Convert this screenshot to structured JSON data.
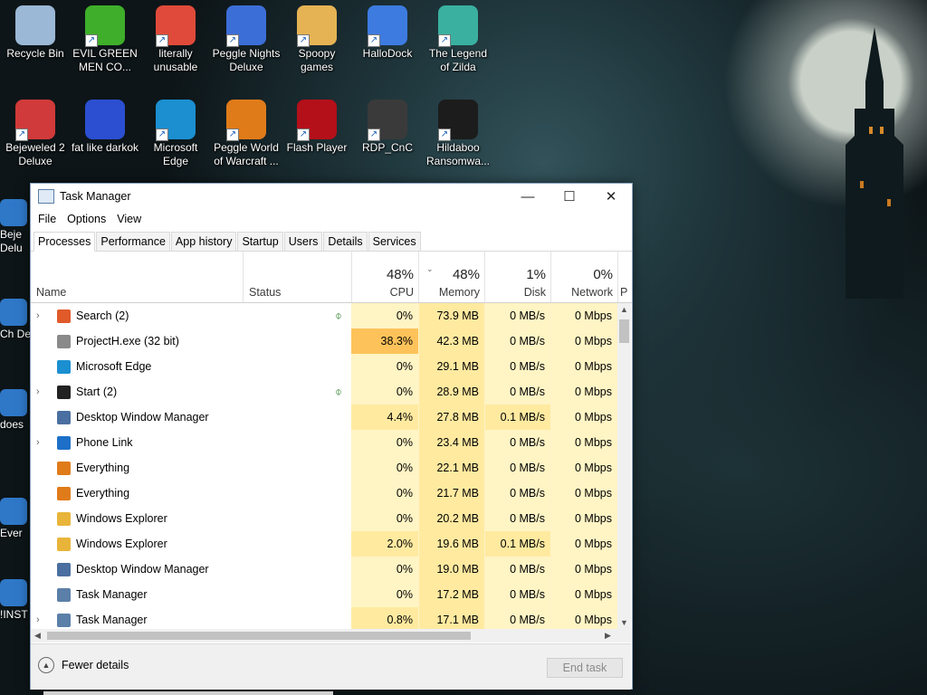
{
  "desktop": {
    "icons": [
      {
        "label": "Recycle Bin",
        "icon": "recycle-bin-icon",
        "color": "#9bb8d6"
      },
      {
        "label": "EVIL GREEN MEN CO...",
        "icon": "green-men-icon",
        "color": "#3fae2a"
      },
      {
        "label": "literally unusable",
        "icon": "chrome-icon",
        "color": "#e04a3a"
      },
      {
        "label": "Peggle Nights Deluxe",
        "icon": "peggle-icon",
        "color": "#3c6ed8"
      },
      {
        "label": "Spoopy games",
        "icon": "folder-icon",
        "color": "#e5b354"
      },
      {
        "label": "HalloDock",
        "icon": "windows-shield-icon",
        "color": "#3d7be0"
      },
      {
        "label": "The Legend of Zilda",
        "icon": "zilda-icon",
        "color": "#3ab0a0"
      },
      {
        "label": "Bejeweled 2 Deluxe",
        "icon": "bejeweled-icon",
        "color": "#d03a3a"
      },
      {
        "label": "fat like darkok",
        "icon": "mpl-icon",
        "color": "#2b4fd0"
      },
      {
        "label": "Microsoft Edge",
        "icon": "edge-icon",
        "color": "#1b8fd0"
      },
      {
        "label": "Peggle World of Warcraft ...",
        "icon": "peggle-wow-icon",
        "color": "#e07b1a"
      },
      {
        "label": "Flash Player",
        "icon": "flash-icon",
        "color": "#b3101a"
      },
      {
        "label": "RDP_CnC",
        "icon": "rdp-icon",
        "color": "#3a3a3a"
      },
      {
        "label": "Hildaboo Ransomwa...",
        "icon": "yashma-icon",
        "color": "#1c1c1c"
      }
    ],
    "partial_icons": [
      {
        "label": "Beje Delu"
      },
      {
        "label": "Ch De"
      },
      {
        "label": "does"
      },
      {
        "label": "Ever"
      },
      {
        "label": "!INST"
      }
    ]
  },
  "task_manager": {
    "title": "Task Manager",
    "menu": [
      "File",
      "Options",
      "View"
    ],
    "tabs": [
      "Processes",
      "Performance",
      "App history",
      "Startup",
      "Users",
      "Details",
      "Services"
    ],
    "active_tab": "Processes",
    "columns": {
      "name": "Name",
      "status": "Status",
      "cpu": {
        "label": "CPU",
        "pct": "48%"
      },
      "memory": {
        "label": "Memory",
        "pct": "48%"
      },
      "disk": {
        "label": "Disk",
        "pct": "1%"
      },
      "network": {
        "label": "Network",
        "pct": "0%"
      },
      "next": "P"
    },
    "processes": [
      {
        "name": "Search (2)",
        "expand": "›",
        "leaf": "⌽",
        "cpu": "0%",
        "mem": "73.9 MB",
        "disk": "0 MB/s",
        "net": "0 Mbps",
        "icon": "search-icon",
        "color": "#e05a2a"
      },
      {
        "name": "ProjectH.exe (32 bit)",
        "expand": "",
        "leaf": "",
        "cpu": "38.3%",
        "mem": "42.3 MB",
        "disk": "0 MB/s",
        "net": "0 Mbps",
        "icon": "app-icon",
        "color": "#8a8a8a"
      },
      {
        "name": "Microsoft Edge",
        "expand": "",
        "leaf": "",
        "cpu": "0%",
        "mem": "29.1 MB",
        "disk": "0 MB/s",
        "net": "0 Mbps",
        "icon": "edge-icon",
        "color": "#1b8fd0"
      },
      {
        "name": "Start (2)",
        "expand": "›",
        "leaf": "⌽",
        "cpu": "0%",
        "mem": "28.9 MB",
        "disk": "0 MB/s",
        "net": "0 Mbps",
        "icon": "start-icon",
        "color": "#222222"
      },
      {
        "name": "Desktop Window Manager",
        "expand": "",
        "leaf": "",
        "cpu": "4.4%",
        "mem": "27.8 MB",
        "disk": "0.1 MB/s",
        "net": "0 Mbps",
        "icon": "window-icon",
        "color": "#4a6fa0"
      },
      {
        "name": "Phone Link",
        "expand": "›",
        "leaf": "",
        "cpu": "0%",
        "mem": "23.4 MB",
        "disk": "0 MB/s",
        "net": "0 Mbps",
        "icon": "phone-link-icon",
        "color": "#1e6fc8"
      },
      {
        "name": "Everything",
        "expand": "",
        "leaf": "",
        "cpu": "0%",
        "mem": "22.1 MB",
        "disk": "0 MB/s",
        "net": "0 Mbps",
        "icon": "everything-icon",
        "color": "#e07b1a"
      },
      {
        "name": "Everything",
        "expand": "",
        "leaf": "",
        "cpu": "0%",
        "mem": "21.7 MB",
        "disk": "0 MB/s",
        "net": "0 Mbps",
        "icon": "everything-icon",
        "color": "#e07b1a"
      },
      {
        "name": "Windows Explorer",
        "expand": "",
        "leaf": "",
        "cpu": "0%",
        "mem": "20.2 MB",
        "disk": "0 MB/s",
        "net": "0 Mbps",
        "icon": "explorer-icon",
        "color": "#e8b53a"
      },
      {
        "name": "Windows Explorer",
        "expand": "",
        "leaf": "",
        "cpu": "2.0%",
        "mem": "19.6 MB",
        "disk": "0.1 MB/s",
        "net": "0 Mbps",
        "icon": "explorer-icon",
        "color": "#e8b53a"
      },
      {
        "name": "Desktop Window Manager",
        "expand": "",
        "leaf": "",
        "cpu": "0%",
        "mem": "19.0 MB",
        "disk": "0 MB/s",
        "net": "0 Mbps",
        "icon": "window-icon",
        "color": "#4a6fa0"
      },
      {
        "name": "Task Manager",
        "expand": "",
        "leaf": "",
        "cpu": "0%",
        "mem": "17.2 MB",
        "disk": "0 MB/s",
        "net": "0 Mbps",
        "icon": "task-manager-icon",
        "color": "#5b7fa8"
      },
      {
        "name": "Task Manager",
        "expand": "›",
        "leaf": "",
        "cpu": "0.8%",
        "mem": "17.1 MB",
        "disk": "0 MB/s",
        "net": "0 Mbps",
        "icon": "task-manager-icon",
        "color": "#5b7fa8"
      }
    ],
    "heat_colors": {
      "low": "#fff4c4",
      "mid": "#ffeaa0",
      "high": "#fdc35a"
    },
    "footer": {
      "fewer_details": "Fewer details",
      "end_task": "End task"
    }
  }
}
